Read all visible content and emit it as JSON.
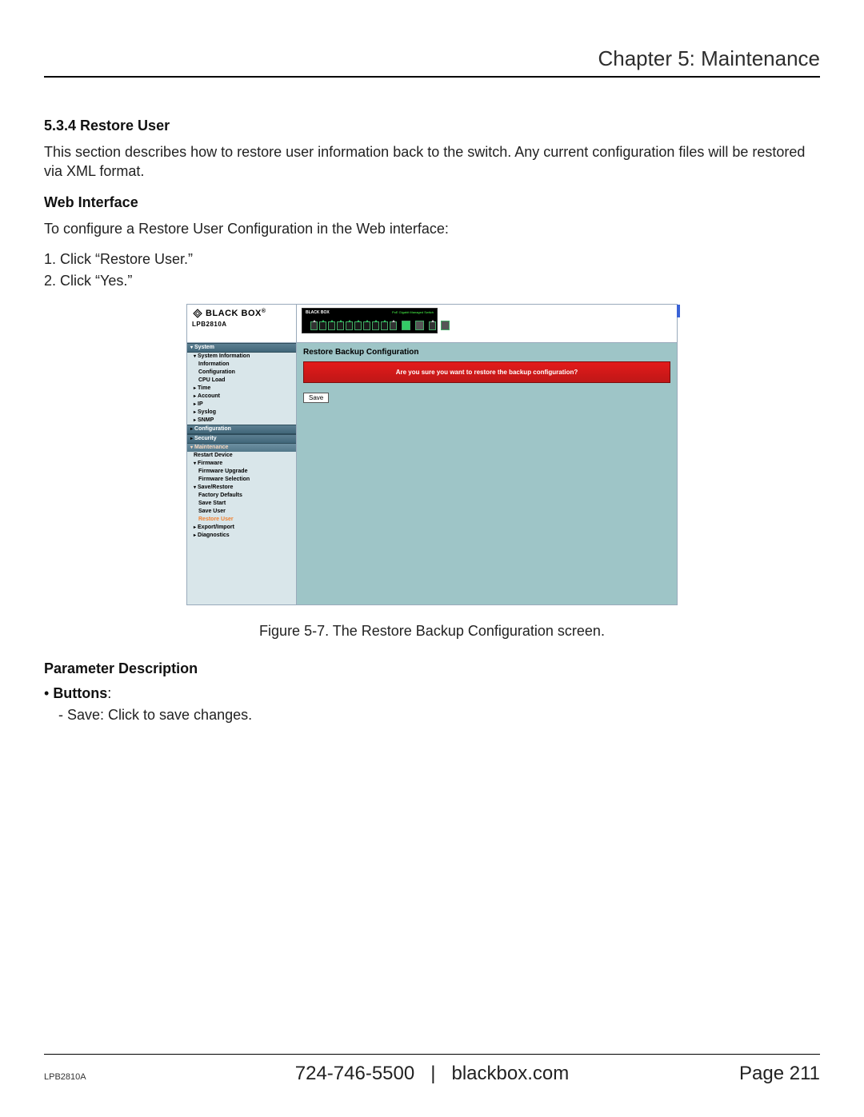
{
  "header": {
    "chapter": "Chapter 5: Maintenance"
  },
  "section": {
    "number": "5.3.4 Restore User",
    "intro": "This section describes how to restore user information back to the switch. Any current configuration files will be restored via XML format.",
    "sub_head": "Web Interface",
    "sub_intro": "To configure a Restore User Configuration in the Web interface:",
    "step1": "1. Click “Restore User.”",
    "step2": "2. Click “Yes.”"
  },
  "screenshot": {
    "logo_brand": "BLACK BOX",
    "logo_model": "LPB2810A",
    "device_brand": "BLACK BOX",
    "device_label": "PoE Gigabit Managed Switch",
    "nav": {
      "system": "System",
      "system_info": "System Information",
      "information": "Information",
      "configuration_item": "Configuration",
      "cpu_load": "CPU Load",
      "time": "Time",
      "account": "Account",
      "ip": "IP",
      "syslog": "Syslog",
      "snmp": "SNMP",
      "configuration": "Configuration",
      "security": "Security",
      "maintenance": "Maintenance",
      "restart": "Restart Device",
      "firmware": "Firmware",
      "fw_upgrade": "Firmware Upgrade",
      "fw_selection": "Firmware Selection",
      "save_restore": "Save/Restore",
      "factory_defaults": "Factory Defaults",
      "save_start": "Save Start",
      "save_user": "Save User",
      "restore_user": "Restore User",
      "export_import": "Export/Import",
      "diagnostics": "Diagnostics"
    },
    "panel_title": "Restore Backup Configuration",
    "confirm_msg": "Are you sure you want to restore the backup configuration?",
    "save_btn": "Save"
  },
  "figure_caption": "Figure 5-7. The Restore Backup Configuration screen.",
  "params": {
    "heading": "Parameter Description",
    "buttons_label": "Buttons",
    "save_desc": "- Save: Click to save changes."
  },
  "footer": {
    "model": "LPB2810A",
    "phone": "724-746-5500",
    "sep": "|",
    "site": "blackbox.com",
    "page": "Page 211"
  }
}
